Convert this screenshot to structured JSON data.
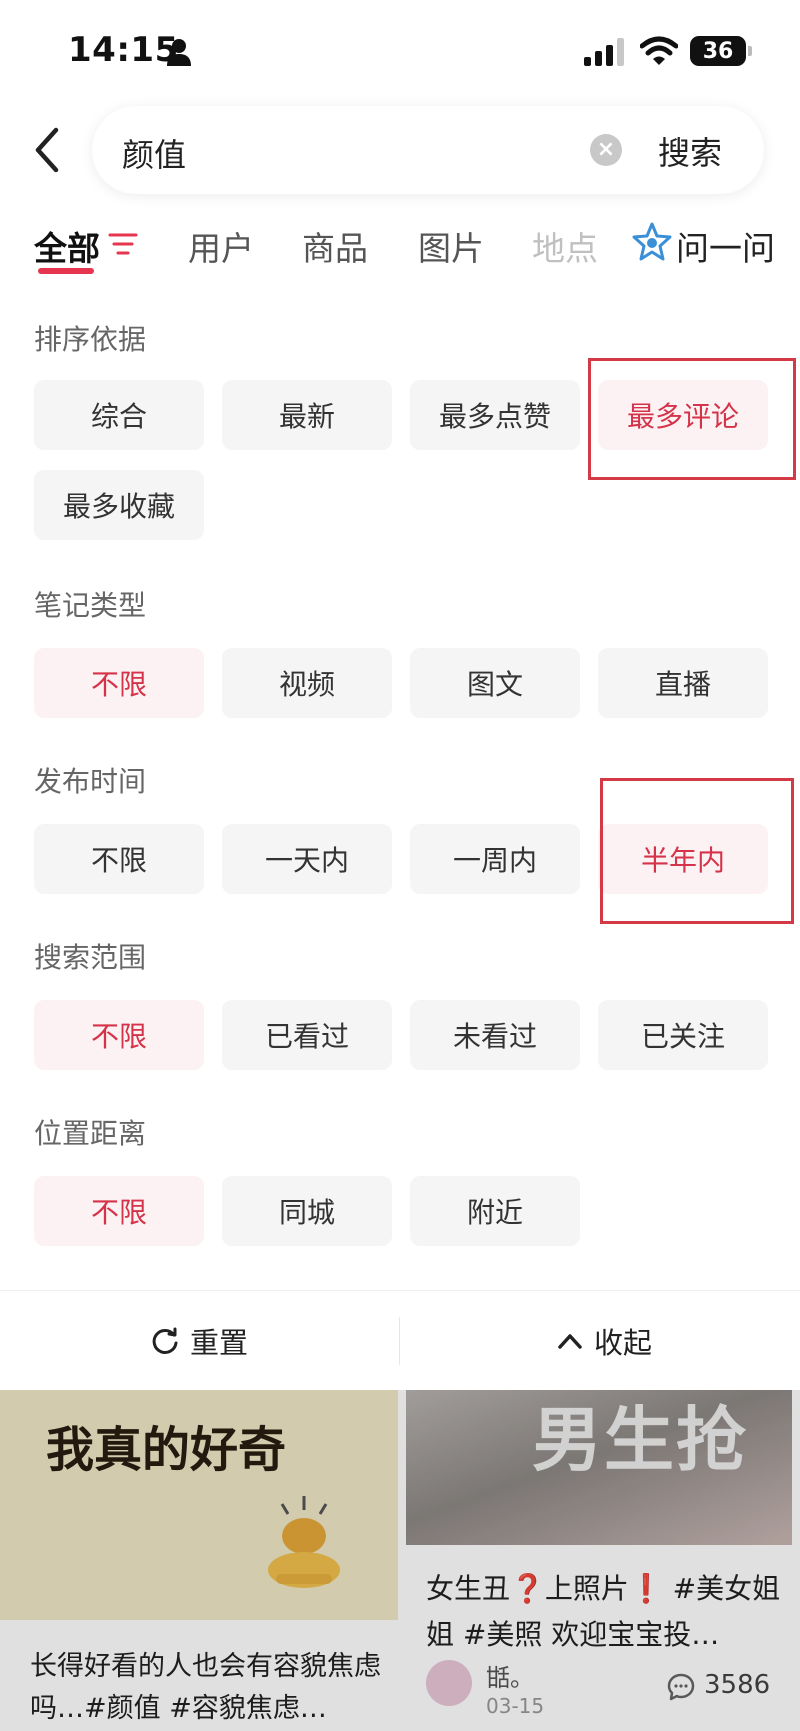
{
  "status_bar": {
    "time": "14:15",
    "battery": "36",
    "icons": [
      "person-icon",
      "signal-icon",
      "wifi-icon",
      "battery-icon"
    ]
  },
  "search": {
    "query": "颜值",
    "submit_label": "搜索"
  },
  "tabs": [
    {
      "label": "全部",
      "active": true
    },
    {
      "label": "用户"
    },
    {
      "label": "商品"
    },
    {
      "label": "图片"
    },
    {
      "label": "地点"
    },
    {
      "label": "问一问"
    }
  ],
  "filters": {
    "sort": {
      "title": "排序依据",
      "options": [
        "综合",
        "最新",
        "最多点赞",
        "最多评论",
        "最多收藏"
      ]
    },
    "note_type": {
      "title": "笔记类型",
      "options": [
        "不限",
        "视频",
        "图文",
        "直播"
      ]
    },
    "publish_time": {
      "title": "发布时间",
      "options": [
        "不限",
        "一天内",
        "一周内",
        "半年内"
      ]
    },
    "scope": {
      "title": "搜索范围",
      "options": [
        "不限",
        "已看过",
        "未看过",
        "已关注"
      ]
    },
    "location": {
      "title": "位置距离",
      "options": [
        "不限",
        "同城",
        "附近"
      ]
    }
  },
  "bottom_bar": {
    "reset_label": "重置",
    "collapse_label": "收起"
  },
  "feed": {
    "left_card": {
      "headline": "我真的好奇",
      "caption": "长得好看的人也会有容貌焦虑吗…#颜值 #容貌焦虑…"
    },
    "right_card": {
      "overlay_text": "男生抢",
      "caption_part1": "女生丑",
      "caption_mark1": "❓",
      "caption_part2": "上照片",
      "caption_mark2": "❗",
      "caption_part3": " #美女姐姐 #美照 欢迎宝宝投…",
      "author": "甛。",
      "date": "03-15",
      "comment_count": "3586"
    }
  },
  "colors": {
    "accent": "#d5334a",
    "chip_bg": "#f5f5f5",
    "chip_selected_bg": "#fdf2f3",
    "annotation_red": "#d43a45"
  }
}
